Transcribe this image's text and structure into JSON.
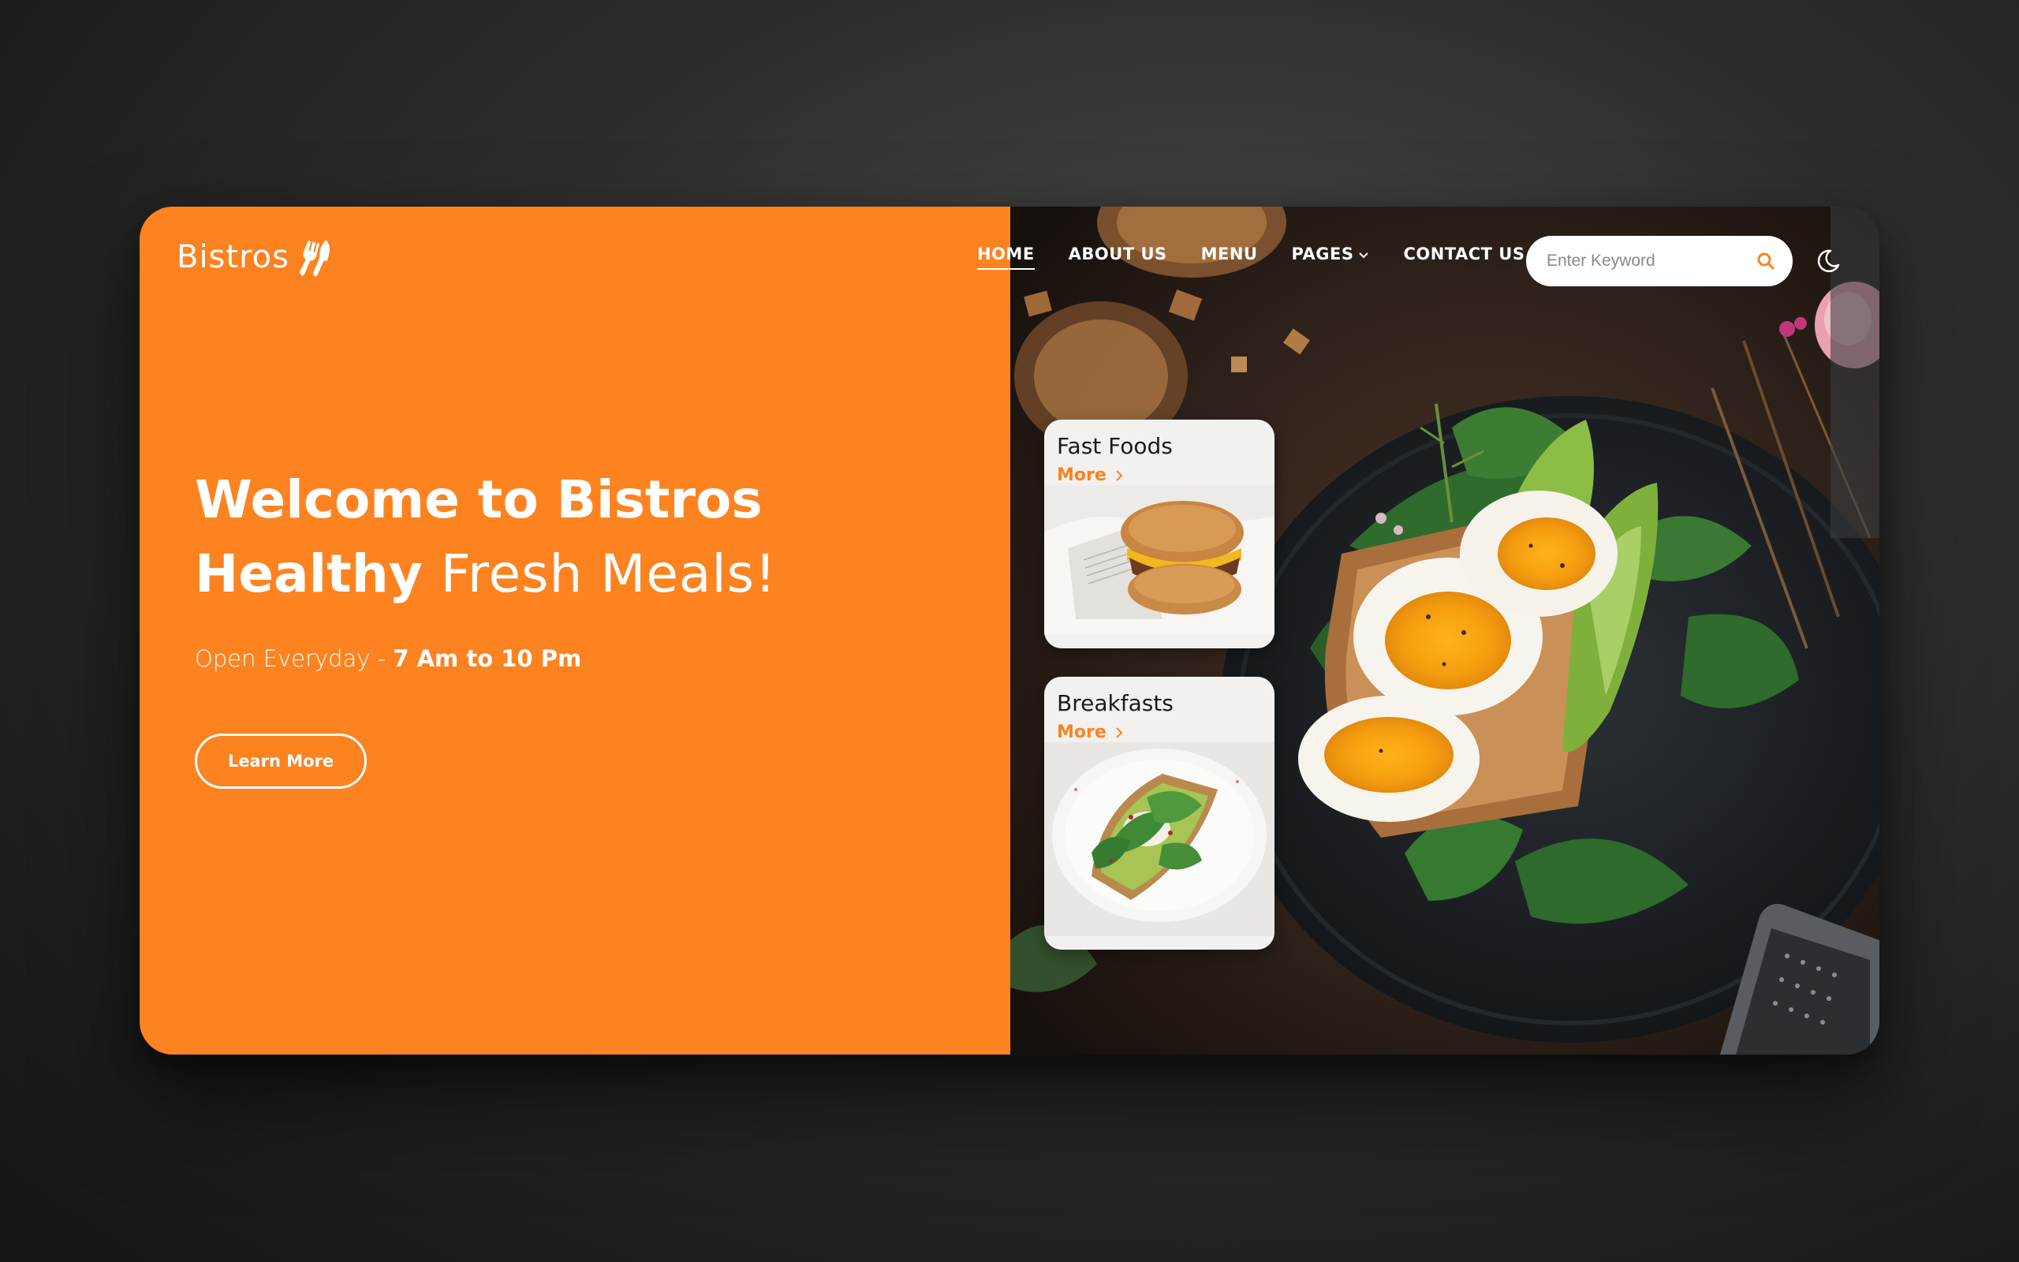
{
  "brand": {
    "name": "Bistros",
    "accent_color": "#fc8320"
  },
  "nav": {
    "items": [
      {
        "label": "HOME",
        "active": true
      },
      {
        "label": "ABOUT US",
        "active": false
      },
      {
        "label": "MENU",
        "active": false
      },
      {
        "label": "PAGES",
        "active": false,
        "has_dropdown": true
      },
      {
        "label": "CONTACT US",
        "active": false
      }
    ]
  },
  "search": {
    "placeholder": "Enter Keyword",
    "value": "",
    "icon": "search-icon"
  },
  "theme_toggle": {
    "icon": "moon-icon"
  },
  "hero": {
    "title_line1": "Welcome to Bistros",
    "title_line2_bold": "Healthy",
    "title_line2_light": "Fresh Meals!",
    "hours_label": "Open Everyday -",
    "hours_time": "7 Am to 10 Pm",
    "cta_label": "Learn More"
  },
  "categories": [
    {
      "title": "Fast Foods",
      "more_label": "More",
      "image": "burger-image"
    },
    {
      "title": "Breakfasts",
      "more_label": "More",
      "image": "avocado-toast-image"
    }
  ]
}
